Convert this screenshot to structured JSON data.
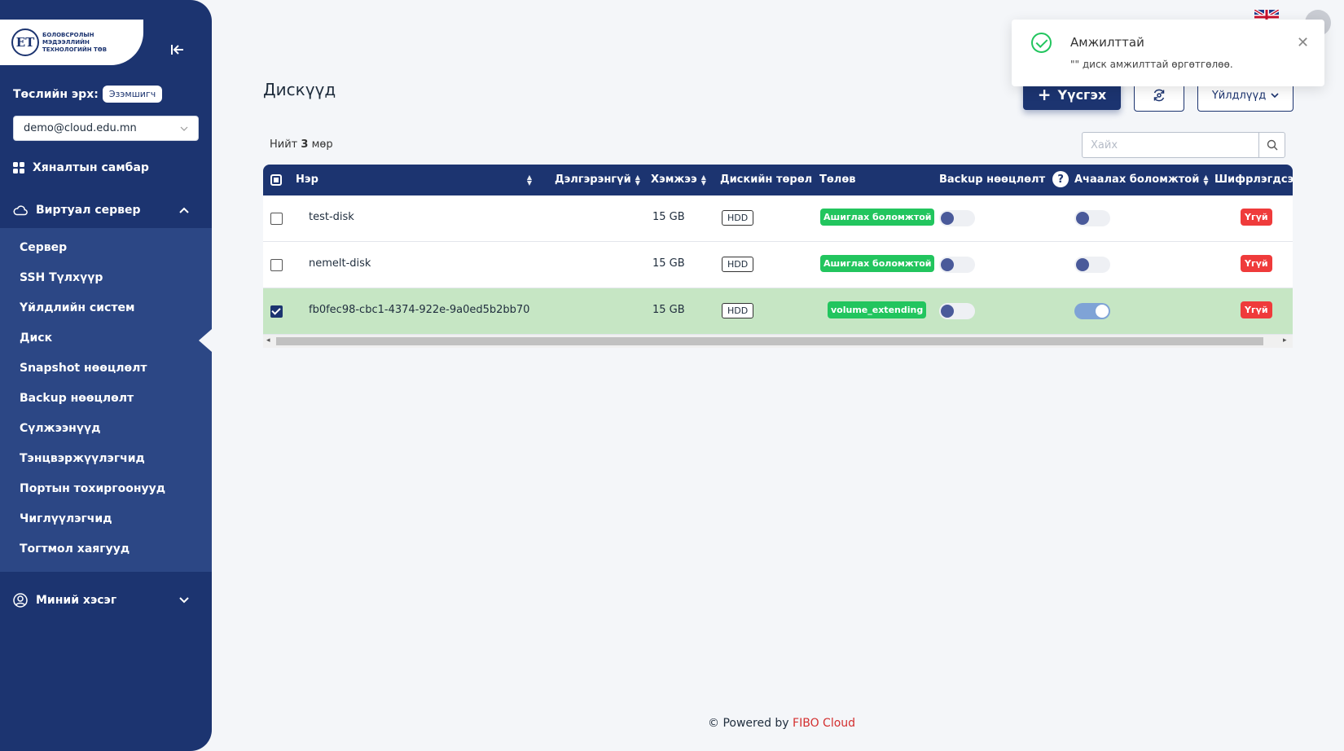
{
  "sidebar": {
    "logo_text": "БОЛОВСРОЛЫН МЭДЭЭЛЛИЙН ТЕХНОЛОГИЙН ТӨВ",
    "logo_mark": "ЕТ",
    "collapse_icon": "collapse-left-icon",
    "role_label": "Төслийн эрх:",
    "role_value": "Эзэмшигч",
    "account": "demo@cloud.edu.mn",
    "dashboard": "Хяналтын самбар",
    "virtual_server": "Виртуал сервер",
    "submenu": [
      "Сервер",
      "SSH Түлхүүр",
      "Үйлдлийн систем",
      "Диск",
      "Snapshot нөөцлөлт",
      "Backup нөөцлөлт",
      "Сүлжээнүүд",
      "Тэнцвэржүүлэгчид",
      "Портын тохиргоонууд",
      "Чиглүүлэгчид",
      "Тогтмол хаягууд"
    ],
    "my_section": "Миний хэсэг"
  },
  "main": {
    "title": "Дискүүд",
    "create_label": "Үүсгэх",
    "actions_label": "Үйлдлүүд",
    "total_prefix": "Нийт",
    "total_count": "3",
    "total_suffix": "мөр",
    "search_placeholder": "Хайх"
  },
  "table": {
    "headers": {
      "name": "Нэр",
      "details": "Дэлгэрэнгүй",
      "size": "Хэмжээ",
      "type": "Дискийн төрөл",
      "status": "Төлөв",
      "backup": "Backup нөөцлөлт",
      "help": "?",
      "bootable": "Ачаалах боломжтой",
      "encrypted": "Шифрлэгдсэн"
    },
    "rows": [
      {
        "name": "test-disk",
        "size": "15 GB",
        "type": "HDD",
        "status": "Ашиглах боломжтой",
        "backup": false,
        "bootable": false,
        "encrypted": "Үгүй",
        "selected": false
      },
      {
        "name": "nemelt-disk",
        "size": "15 GB",
        "type": "HDD",
        "status": "Ашиглах боломжтой",
        "backup": false,
        "bootable": false,
        "encrypted": "Үгүй",
        "selected": false
      },
      {
        "name": "fb0fec98-cbc1-4374-922e-9a0ed5b2bb70",
        "size": "15 GB",
        "type": "HDD",
        "status": "volume_extending",
        "backup": false,
        "bootable": true,
        "encrypted": "Үгүй",
        "selected": true
      }
    ]
  },
  "footer": {
    "prefix": "© Powered by",
    "brand": "FIBO Cloud"
  },
  "toast": {
    "title": "Амжилттай",
    "message": "\"\" диск амжилттай өргөтгөлөө."
  },
  "colors": {
    "primary": "#1c3470",
    "success": "#22c55e",
    "danger": "#ef3b3b",
    "selected_row": "#c6e6c4"
  }
}
